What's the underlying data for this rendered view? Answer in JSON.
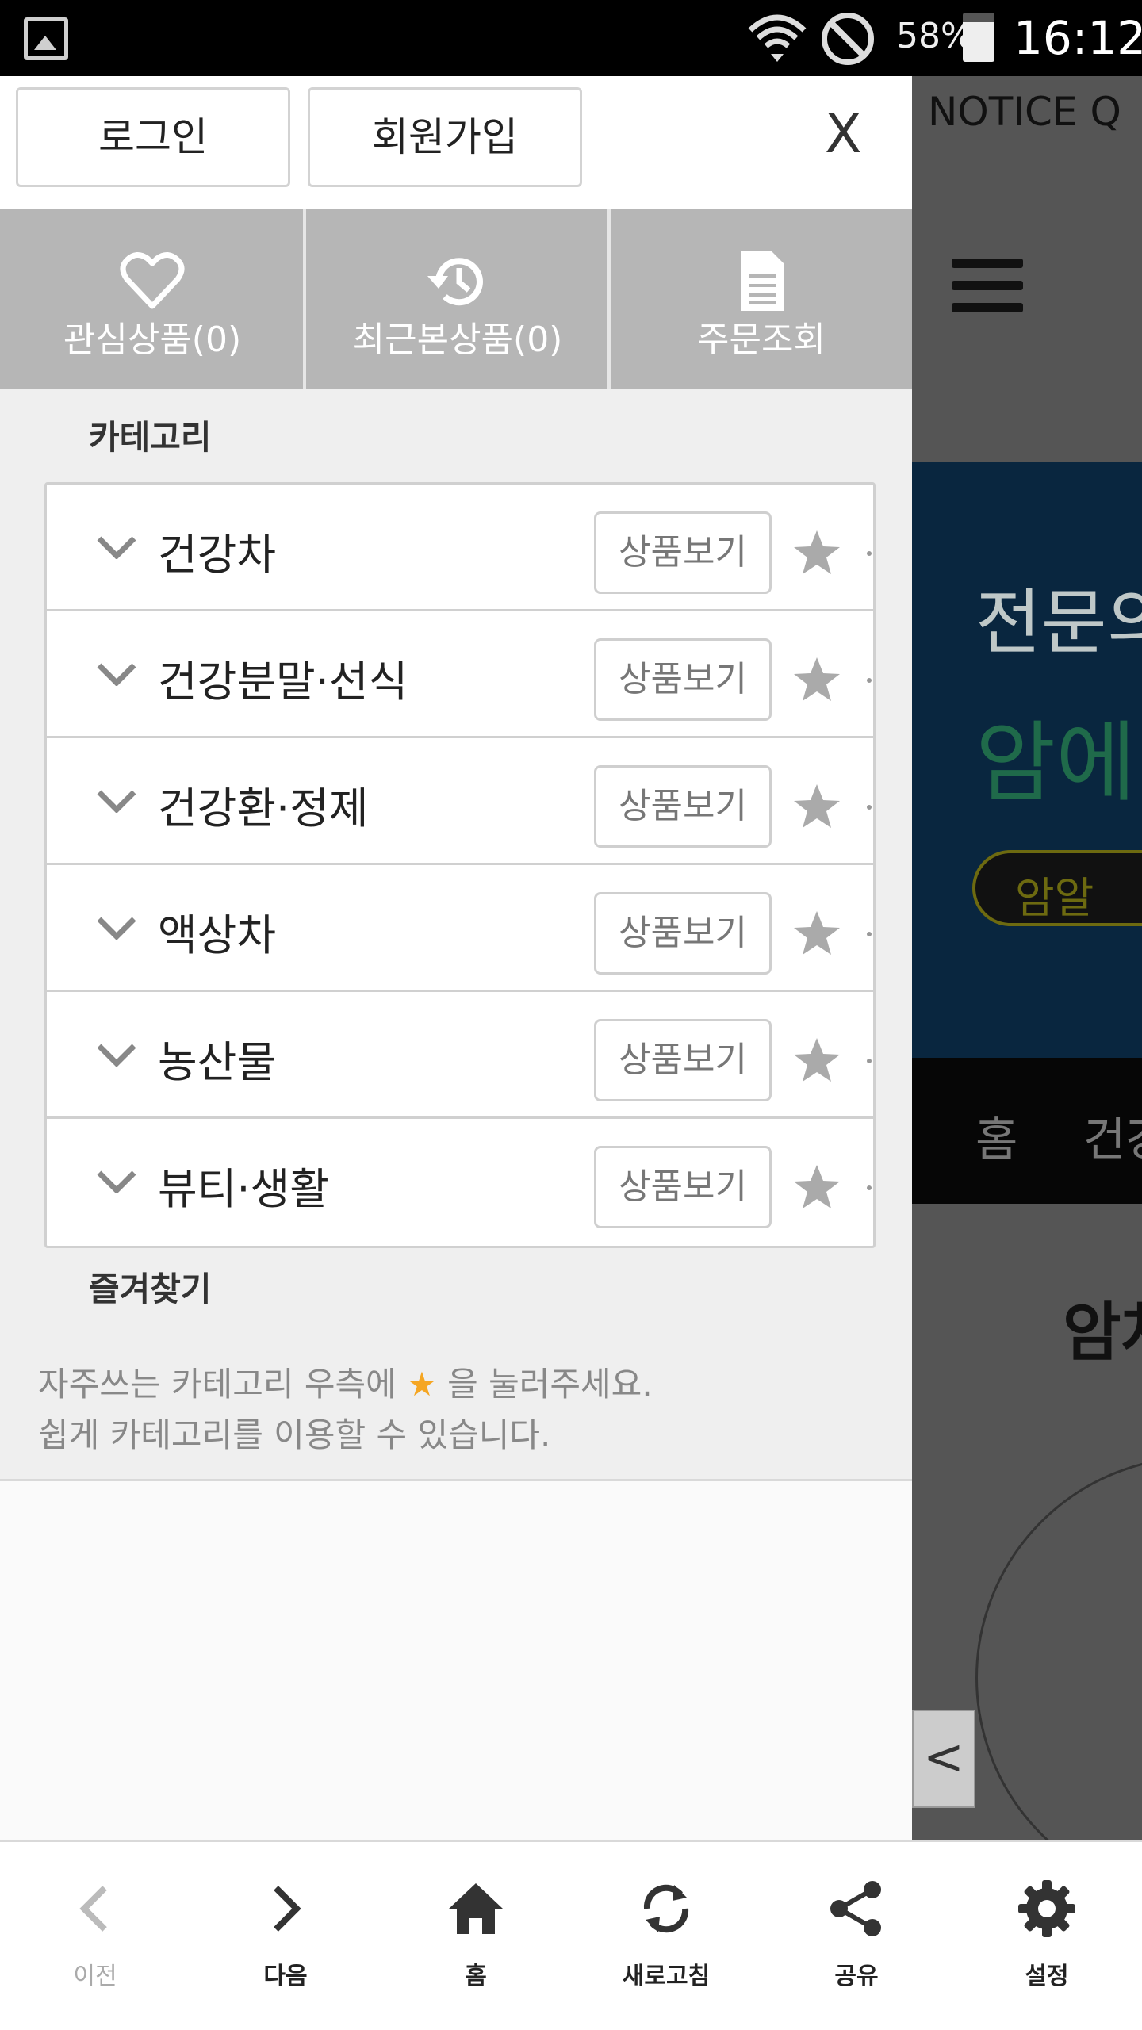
{
  "status_bar": {
    "battery_percent": "58%",
    "time": "16:12",
    "icons": [
      "gallery-icon",
      "wifi-icon",
      "block-icon",
      "battery-icon"
    ]
  },
  "background_page": {
    "notice": "NOTICE  Q",
    "banner_line1": "전문의",
    "banner_line2": "암에",
    "banner_pill": "암알",
    "nav_items": [
      "홈",
      "건강"
    ],
    "heading": "암차",
    "prev_arrow": "<"
  },
  "drawer": {
    "login_label": "로그인",
    "signup_label": "회원가입",
    "close_label": "X",
    "quick_links": [
      {
        "label": "관심상품(0)",
        "icon": "heart-icon"
      },
      {
        "label": "최근본상품(0)",
        "icon": "history-icon"
      },
      {
        "label": "주문조회",
        "icon": "document-icon"
      }
    ],
    "category_title": "카테고리",
    "categories": [
      {
        "label": "건강차",
        "button": "상품보기"
      },
      {
        "label": "건강분말·선식",
        "button": "상품보기"
      },
      {
        "label": "건강환·정제",
        "button": "상품보기"
      },
      {
        "label": "액상차",
        "button": "상품보기"
      },
      {
        "label": "농산물",
        "button": "상품보기"
      },
      {
        "label": "뷰티·생활",
        "button": "상품보기"
      }
    ],
    "favorites_title": "즐겨찾기",
    "favorites_hint_pre": "자주쓰는 카테고리 우측에",
    "favorites_hint_star": "★",
    "favorites_hint_post": "을 눌러주세요.",
    "favorites_hint_line2": "쉽게 카테고리를 이용할 수 있습니다."
  },
  "bottom_toolbar": {
    "items": [
      {
        "label": "이전",
        "icon": "chevron-left-icon",
        "enabled": false
      },
      {
        "label": "다음",
        "icon": "chevron-right-icon",
        "enabled": true
      },
      {
        "label": "홈",
        "icon": "home-icon",
        "enabled": true
      },
      {
        "label": "새로고침",
        "icon": "refresh-icon",
        "enabled": true
      },
      {
        "label": "공유",
        "icon": "share-icon",
        "enabled": true
      },
      {
        "label": "설정",
        "icon": "gear-icon",
        "enabled": true
      }
    ]
  },
  "colors": {
    "quick_bar_bg": "#b6b6b6",
    "star_accent": "#f5a623",
    "drawer_bg": "#efefef"
  }
}
